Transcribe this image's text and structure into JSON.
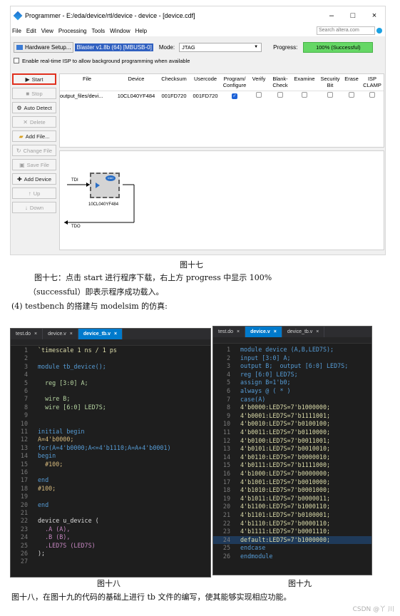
{
  "programmer": {
    "title": "Programmer - E:/eda/device/rtl/device - device - [device.cdf]",
    "window_controls": [
      "–",
      "□",
      "×"
    ],
    "menu": [
      "File",
      "Edit",
      "View",
      "Processing",
      "Tools",
      "Window",
      "Help"
    ],
    "search_placeholder": "Search altera.com",
    "hardware_setup_label": "Hardware Setup...",
    "hardware_value": "Blaster v1.8b (64) [MBUSB-0]",
    "mode_label": "Mode:",
    "mode_value": "JTAG",
    "progress_label": "Progress:",
    "progress_text": "100% (Successful)",
    "progress_fraction": 1.0,
    "isp_label": "Enable real-time ISP to allow background programming when available",
    "side_buttons": [
      {
        "label": "Start",
        "icon": "start-icon",
        "enabled": true
      },
      {
        "label": "Stop",
        "icon": "stop-icon",
        "enabled": false
      },
      {
        "label": "Auto Detect",
        "icon": "auto-detect-icon",
        "enabled": true
      },
      {
        "label": "Delete",
        "icon": "delete-icon",
        "enabled": false
      },
      {
        "label": "Add File...",
        "icon": "add-file-icon",
        "enabled": true
      },
      {
        "label": "Change File",
        "icon": "change-file-icon",
        "enabled": false
      },
      {
        "label": "Save File",
        "icon": "save-file-icon",
        "enabled": false
      },
      {
        "label": "Add Device",
        "icon": "add-device-icon",
        "enabled": true
      },
      {
        "label": "Up",
        "icon": "up-icon",
        "enabled": false
      },
      {
        "label": "Down",
        "icon": "down-icon",
        "enabled": false
      }
    ],
    "columns": [
      "File",
      "Device",
      "Checksum",
      "Usercode",
      "Program/ Configure",
      "Verify",
      "Blank- Check",
      "Examine",
      "Security Bit",
      "Erase",
      "ISP CLAMP"
    ],
    "row": {
      "file": "output_files/devi...",
      "device": "10CL040YF484",
      "checksum": "001FD720",
      "usercode": "001FD720",
      "program": true,
      "verify": false,
      "blank": false,
      "examine": false,
      "security": false,
      "erase": false,
      "isp": false
    },
    "chain": {
      "tdi": "TDI",
      "tdo": "TDO",
      "chip_label": "10CL040YF484",
      "logo": "intel"
    }
  },
  "captions": {
    "fig17": "图十七",
    "fig17_desc1": "图十七：点击 start 进行程序下载，右上方 progress 中显示 100%",
    "fig17_desc2": "（successful）即表示程序成功载入。",
    "section": "(4) testbench 的搭建与 modelsim 的仿真:",
    "fig18": "图十八",
    "fig19": "图十九",
    "bottom": "图十八，在图十九的代码的基础上进行 tb 文件的编写，使其能够实现相应功能。",
    "watermark": "CSDN @丫 川"
  },
  "editor_left": {
    "tabs": [
      {
        "label": "test.do",
        "active": false
      },
      {
        "label": "device.v",
        "active": false
      },
      {
        "label": "device_tb.v",
        "active": true
      }
    ],
    "lines": [
      "`timescale 1 ns / 1 ps",
      "",
      "module tb_device();",
      "",
      "  reg [3:0] A;",
      "",
      "  wire B;",
      "  wire [6:0] LED7S;",
      "",
      "",
      "initial begin",
      "A=4'b0000;",
      "for(A=4'b0000;A<=4'b1110;A=A+4'b0001)",
      "begin",
      "  #100;",
      "",
      "end",
      "#100;",
      "",
      "end",
      "",
      "device u_device (",
      "  .A (A),",
      "  .B (B),",
      "  .LED7S (LED7S)",
      ");",
      ""
    ]
  },
  "editor_right": {
    "tabs": [
      {
        "label": "test.do",
        "active": false
      },
      {
        "label": "device.v",
        "active": true
      },
      {
        "label": "device_tb.v",
        "active": false
      }
    ],
    "lines": [
      "module device (A,B,LED7S);",
      "input [3:0] A;",
      "output B;  output [6:0] LED7S;",
      "reg [6:0] LED7S;",
      "assign B=1'b0;",
      "always @ ( * )",
      "case(A)",
      "4'b0000:LED7S=7'b1000000;",
      "4'b0001:LED7S=7'b1111001;",
      "4'b0010:LED7S=7'b0100100;",
      "4'b0011:LED7S=7'b0110000;",
      "4'b0100:LED7S=7'b0011001;",
      "4'b0101:LED7S=7'b0010010;",
      "4'b0110:LED7S=7'b0000010;",
      "4'b0111:LED7S=7'b1111000;",
      "4'b1000:LED7S=7'b0000000;",
      "4'b1001:LED7S=7'b0010000;",
      "4'b1010:LED7S=7'b0001000;",
      "4'b1011:LED7S=7'b0000011;",
      "4'b1100:LED7S=7'b1000110;",
      "4'b1101:LED7S=7'b0100001;",
      "4'b1110:LED7S=7'b0000110;",
      "4'b1111:LED7S=7'b0001110;",
      "default:LED7S=7'b1000000;",
      "endcase",
      "endmodule"
    ]
  }
}
